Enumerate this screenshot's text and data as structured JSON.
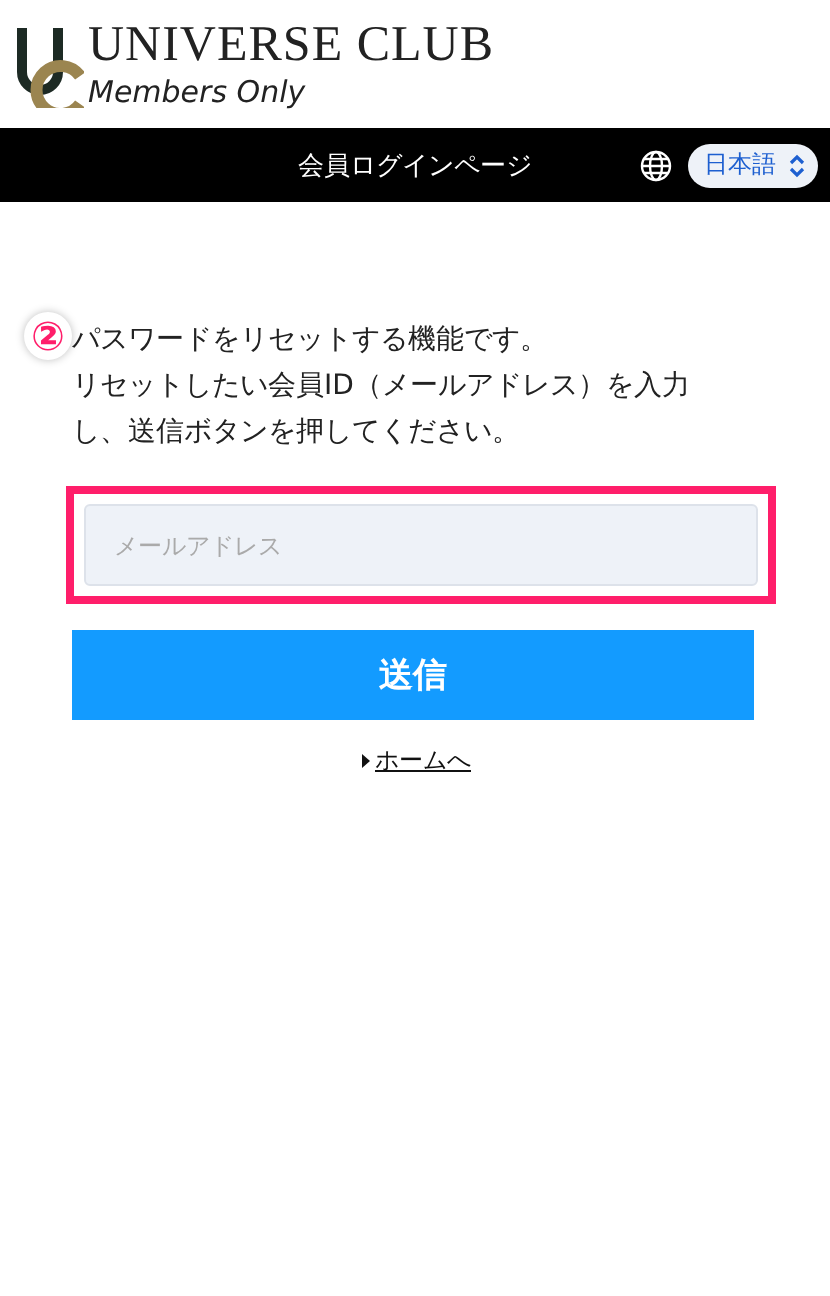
{
  "logo": {
    "title": "UNIVERSE CLUB",
    "subtitle": "Members Only"
  },
  "nav_bar": {
    "title": "会員ログインページ",
    "language": "日本語"
  },
  "step_marker": "②",
  "instructions": [
    "パスワードをリセットする機能です。",
    "リセットしたい会員ID（メールアドレス）を入力し、送信ボタンを押してください。"
  ],
  "email_field": {
    "placeholder": "メールアドレス",
    "highlighted": true
  },
  "submit_button": "送信",
  "home_link": "ホームへ"
}
